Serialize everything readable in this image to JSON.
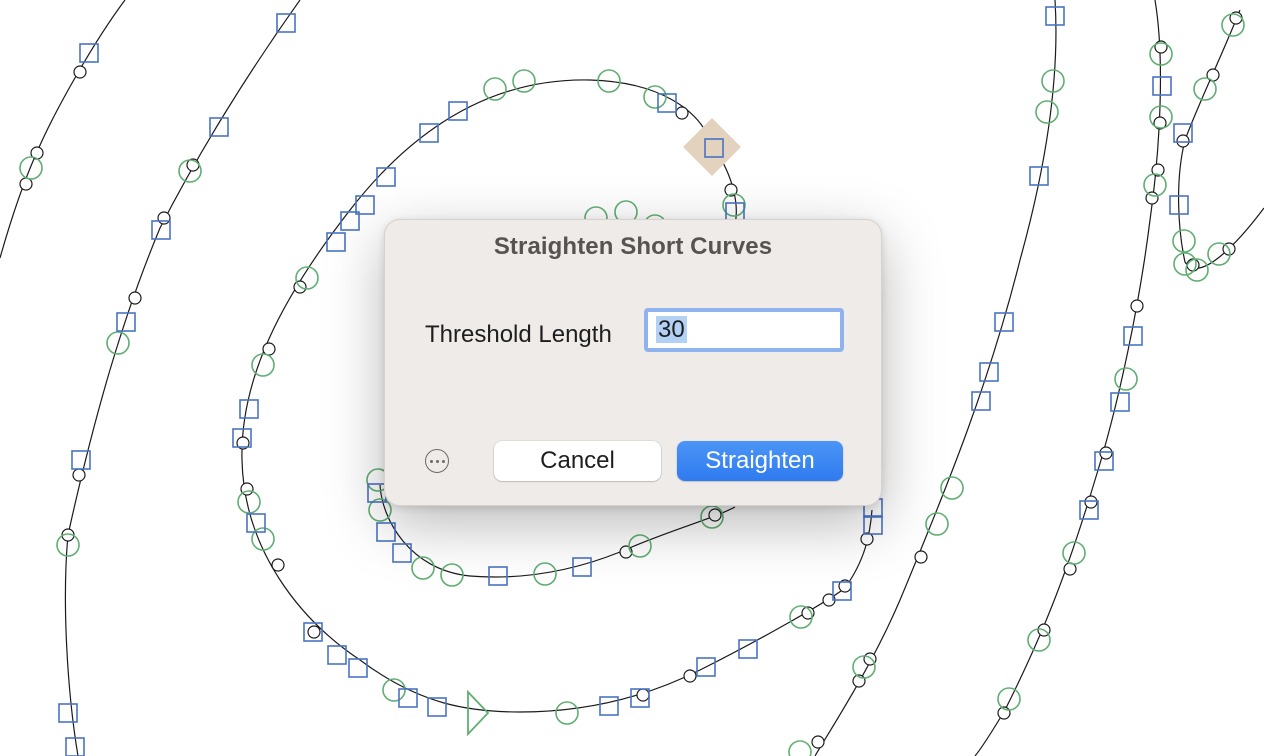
{
  "canvas": {
    "path_color": "#1a1a1a",
    "on_curve_marker_color": "#1a1a1a",
    "smooth_marker_color": "#5fae72",
    "corner_marker_color": "#4a73c4",
    "start_marker_color": "#e3d2bd",
    "direction_marker_color": "#5fae72"
  },
  "dialog": {
    "title": "Straighten Short Curves",
    "threshold_label": "Threshold Length",
    "threshold_value": "30",
    "cancel_label": "Cancel",
    "straighten_label": "Straighten",
    "more_icon": "ellipsis-circle-icon",
    "accent_color": "#3b86f5"
  }
}
